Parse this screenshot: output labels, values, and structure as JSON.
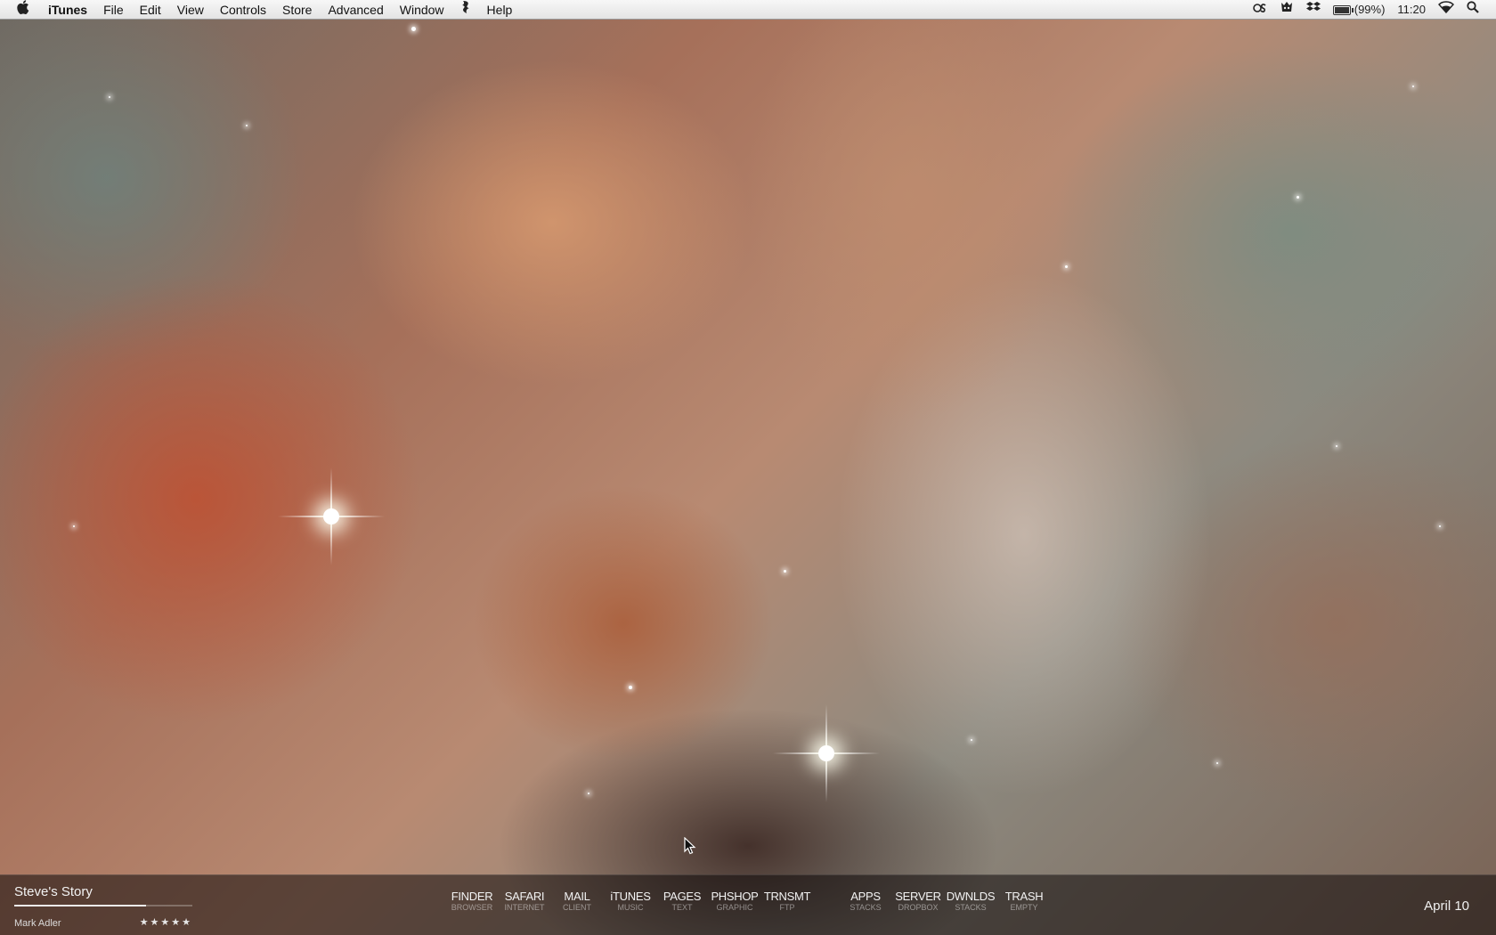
{
  "menubar": {
    "apple_icon": "apple-icon",
    "app_name": "iTunes",
    "menus": [
      "File",
      "Edit",
      "View",
      "Controls",
      "Store",
      "Advanced",
      "Window",
      "Script",
      "Help"
    ],
    "status": {
      "icons": [
        "creative-suite-icon",
        "growl-icon",
        "dropbox-icon",
        "battery-icon",
        "wifi-icon",
        "spotlight-icon"
      ],
      "battery_text": "(99%)",
      "battery_level": 0.99,
      "clock": "11:20"
    }
  },
  "bottombar": {
    "now_playing": {
      "title": "Steve's Story",
      "artist": "Mark Adler",
      "rating": "★★★★★",
      "progress": 0.74
    },
    "launcher": [
      {
        "label": "FINDER",
        "sub": "BROWSER"
      },
      {
        "label": "SAFARI",
        "sub": "INTERNET"
      },
      {
        "label": "MAIL",
        "sub": "CLIENT"
      },
      {
        "label": "iTUNES",
        "sub": "MUSIC"
      },
      {
        "label": "PAGES",
        "sub": "TEXT"
      },
      {
        "label": "PHSHOP",
        "sub": "GRAPHIC"
      },
      {
        "label": "TRNSMT",
        "sub": "FTP"
      },
      {
        "label": "APPS",
        "sub": "STACKS"
      },
      {
        "label": "SERVER",
        "sub": "DROPBOX"
      },
      {
        "label": "DWNLDS",
        "sub": "STACKS"
      },
      {
        "label": "TRASH",
        "sub": "EMPTY"
      }
    ],
    "date": "April 10"
  }
}
